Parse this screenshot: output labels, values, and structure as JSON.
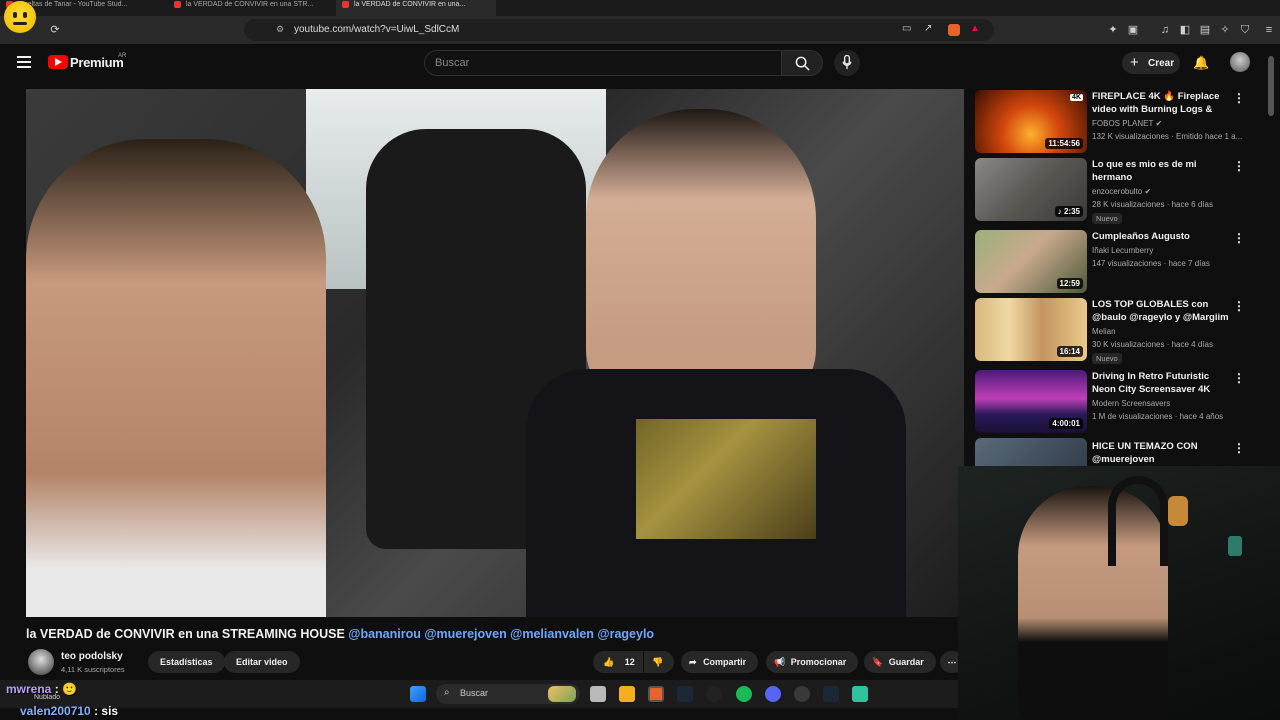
{
  "browser": {
    "tabs": [
      {
        "label": "Mueltas de Tanar - YouTube Stud..."
      },
      {
        "label": "la VERDAD de CONVIVIR en una STR..."
      },
      {
        "label": "la VERDAD de CONVIVIR en una..."
      }
    ],
    "url": "youtube.com/watch?v=UiwL_SdlCcM"
  },
  "yt_header": {
    "logo_text": "Premium",
    "region": "AR",
    "search_placeholder": "Buscar",
    "create_label": "Crear"
  },
  "video": {
    "title_main": "la VERDAD de CONVIVIR en una STREAMING HOUSE ",
    "title_tags": "@bananirou @muerejoven @melianvalen @rageylo"
  },
  "channel": {
    "name": "teo podolsky",
    "subscribers": "4,11 K suscriptores",
    "stats_label": "Estadísticas",
    "edit_label": "Editar video"
  },
  "actions": {
    "likes": "12",
    "share_label": "Compartir",
    "promote_label": "Promocionar",
    "save_label": "Guardar"
  },
  "recommendations": [
    {
      "title": "FIREPLACE 4K 🔥 Fireplace video with Burning Logs & Fire...",
      "channel": "FOBOS PLANET",
      "verified": true,
      "meta": "132 K visualizaciones · Emitido hace 1 a...",
      "duration": "11:54:56",
      "badge": "",
      "thumb_color": "#c4390a"
    },
    {
      "title": "Lo que es mio es de mi hermano",
      "channel": "enzocerobulto",
      "verified": true,
      "meta": "28 K visualizaciones · hace 6 días",
      "duration": "2:35",
      "badge": "Nuevo",
      "thumb_color": "#6e6a66"
    },
    {
      "title": "Cumpleaños Augusto",
      "channel": "Iñaki Lecumberry",
      "verified": false,
      "meta": "147 visualizaciones · hace 7 días",
      "duration": "12:59",
      "badge": "",
      "thumb_color": "#5a6e4a"
    },
    {
      "title": "LOS TOP GLOBALES con @baulo @rageylo y @Margiim",
      "channel": "Melian",
      "verified": false,
      "meta": "30 K visualizaciones · hace 4 días",
      "duration": "16:14",
      "badge": "Nuevo",
      "thumb_color": "#c9a24a"
    },
    {
      "title": "Driving In Retro Futuristic Neon City Screensaver 4K",
      "channel": "Modern Screensavers",
      "verified": false,
      "meta": "1 M de visualizaciones · hace 4 años",
      "duration": "4:00:01",
      "badge": "",
      "thumb_color": "#7a2fa8"
    },
    {
      "title": "HICE UN TEMAZO CON @muerejoven",
      "channel": "",
      "verified": false,
      "meta": "",
      "duration": "",
      "badge": "",
      "thumb_color": "#3a4a5a"
    }
  ],
  "taskbar": {
    "search_label": "Buscar",
    "weather": "Nublado"
  },
  "chat": [
    {
      "user": "mwrena",
      "message": " : 🙂"
    },
    {
      "user": "valen200710",
      "message": " : sis"
    }
  ]
}
